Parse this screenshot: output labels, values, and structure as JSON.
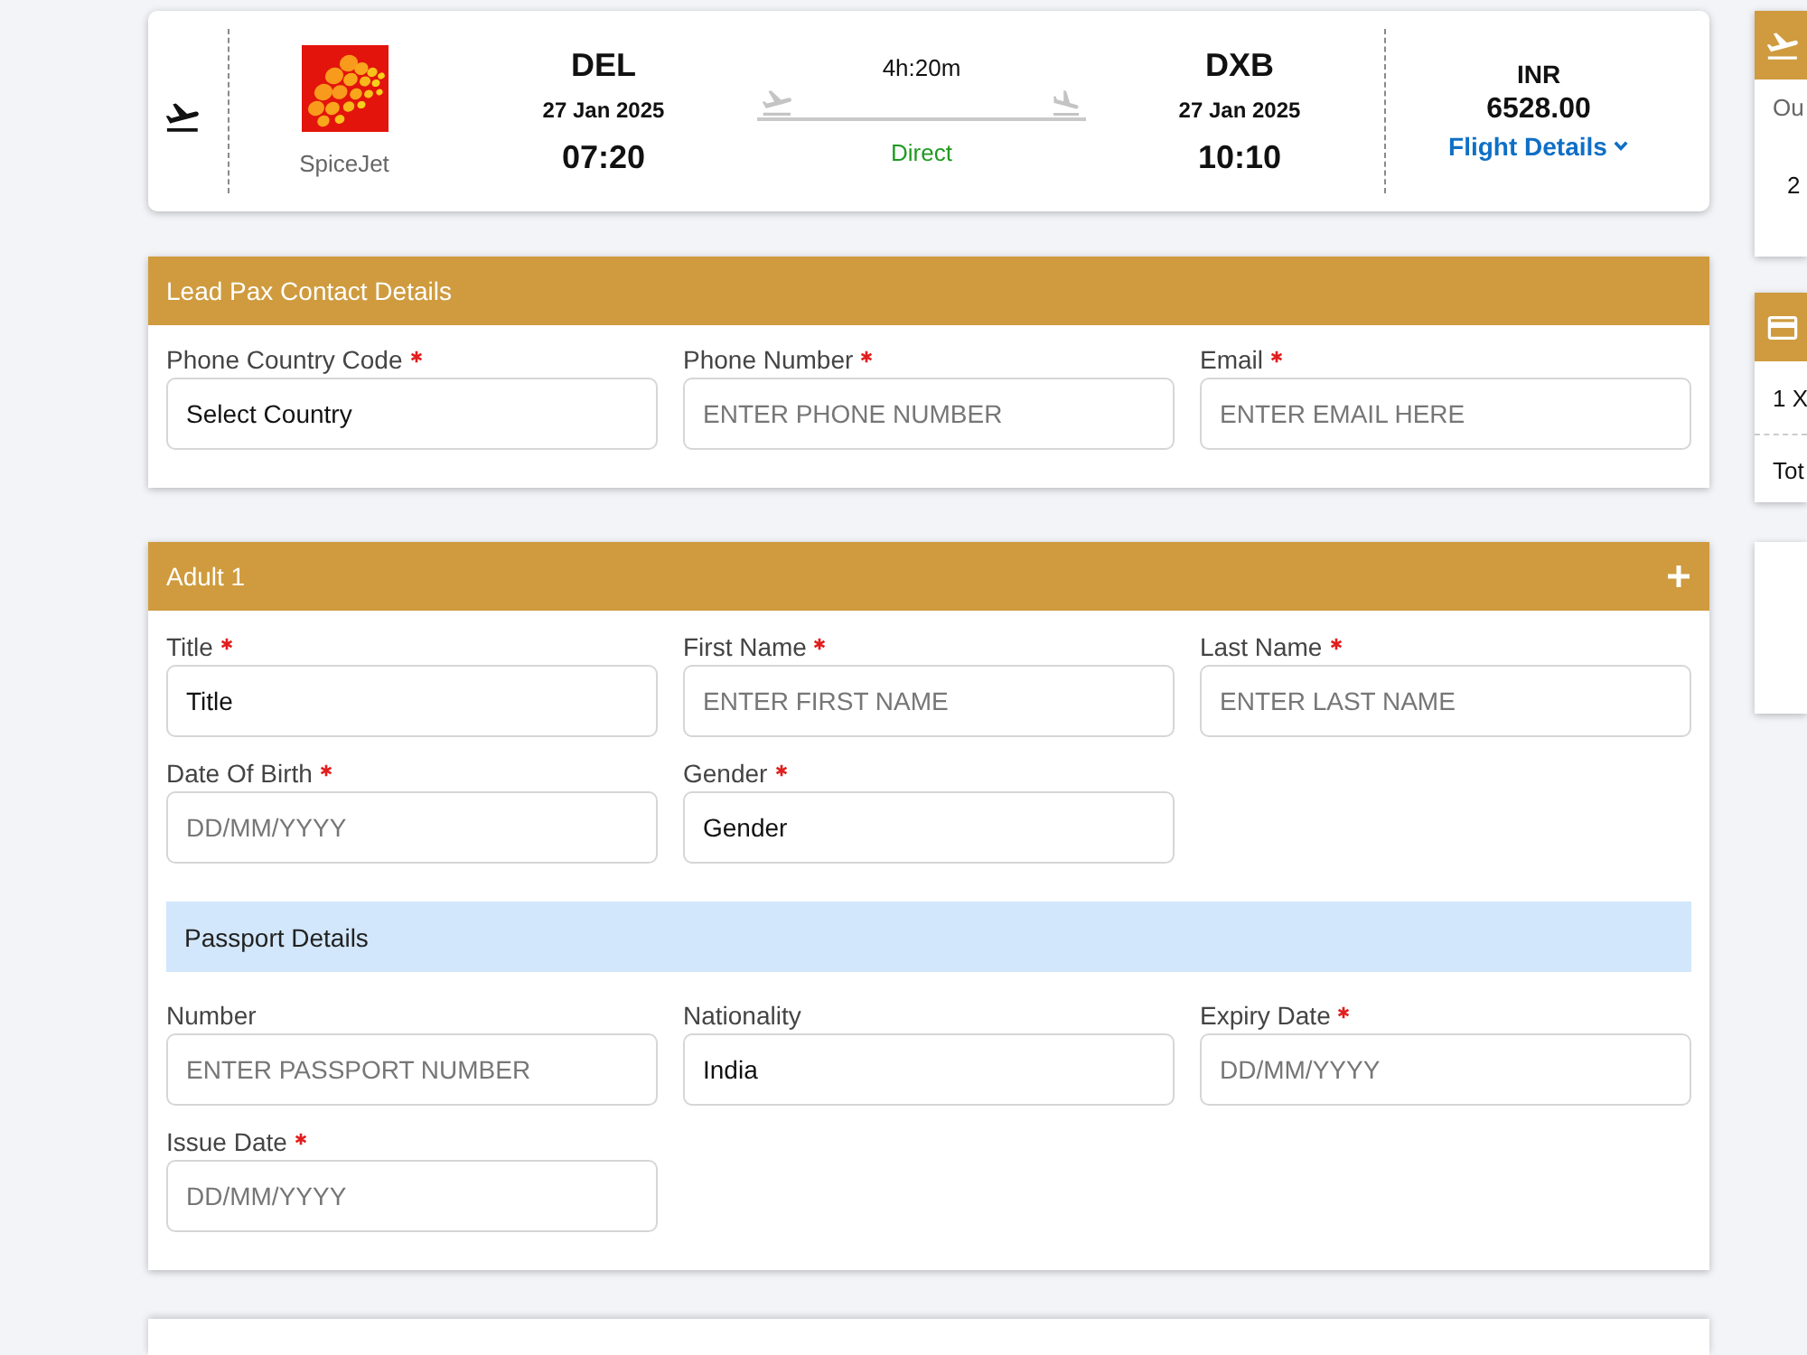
{
  "flight": {
    "airline": "SpiceJet",
    "departure": {
      "code": "DEL",
      "date": "27 Jan 2025",
      "time": "07:20"
    },
    "duration": "4h:20m",
    "stops": "Direct",
    "arrival": {
      "code": "DXB",
      "date": "27 Jan 2025",
      "time": "10:10"
    },
    "currency": "INR",
    "price": "6528.00",
    "details_link": "Flight Details"
  },
  "contact": {
    "title": "Lead Pax Contact Details",
    "fields": [
      {
        "label": "Phone Country Code",
        "required": true,
        "value": "Select Country"
      },
      {
        "label": "Phone Number",
        "required": true,
        "placeholder": "ENTER PHONE NUMBER"
      },
      {
        "label": "Email",
        "required": true,
        "placeholder": "ENTER EMAIL HERE"
      }
    ]
  },
  "passengers": [
    {
      "title": "Adult 1",
      "fields": [
        {
          "label": "Title",
          "required": true,
          "value": "Title"
        },
        {
          "label": "First Name",
          "required": true,
          "placeholder": "ENTER FIRST NAME"
        },
        {
          "label": "Last Name",
          "required": true,
          "placeholder": "ENTER LAST NAME"
        },
        {
          "label": "Date Of Birth",
          "required": true,
          "placeholder": "DD/MM/YYYY"
        },
        {
          "label": "Gender",
          "required": true,
          "value": "Gender"
        }
      ],
      "passport": {
        "title": "Passport Details",
        "fields": [
          {
            "label": "Number",
            "required": false,
            "placeholder": "ENTER PASSPORT NUMBER"
          },
          {
            "label": "Nationality",
            "required": false,
            "value": "India"
          },
          {
            "label": "Expiry Date",
            "required": true,
            "placeholder": "DD/MM/YYYY"
          },
          {
            "label": "Issue Date",
            "required": true,
            "placeholder": "DD/MM/YYYY"
          }
        ]
      }
    }
  ],
  "sidebar": {
    "cards": [
      {
        "kind": "flight",
        "label": "Ou",
        "value": "2"
      },
      {
        "kind": "fare",
        "rows": [
          "1 X",
          "Tot"
        ]
      },
      {
        "kind": "empty"
      }
    ]
  }
}
